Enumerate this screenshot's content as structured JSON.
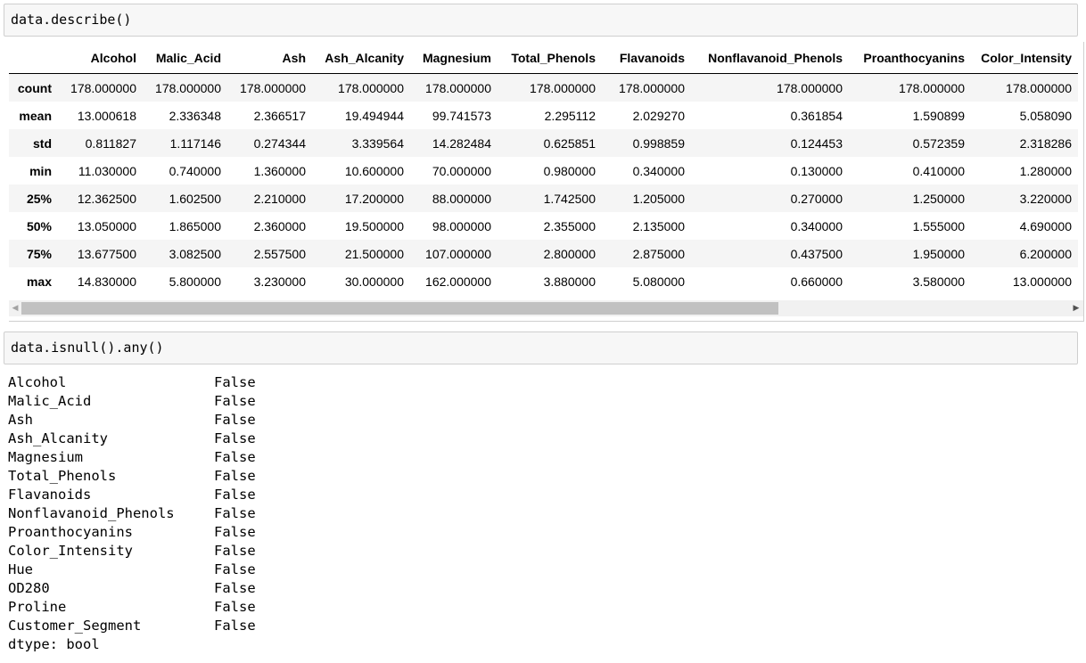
{
  "cells": {
    "describe_code": "data.describe()",
    "isnull_code": "data.isnull().any()"
  },
  "describe_table": {
    "columns": [
      "Alcohol",
      "Malic_Acid",
      "Ash",
      "Ash_Alcanity",
      "Magnesium",
      "Total_Phenols",
      "Flavanoids",
      "Nonflavanoid_Phenols",
      "Proanthocyanins",
      "Color_Intensity"
    ],
    "rows": [
      {
        "label": "count",
        "values": [
          "178.000000",
          "178.000000",
          "178.000000",
          "178.000000",
          "178.000000",
          "178.000000",
          "178.000000",
          "178.000000",
          "178.000000",
          "178.000000"
        ]
      },
      {
        "label": "mean",
        "values": [
          "13.000618",
          "2.336348",
          "2.366517",
          "19.494944",
          "99.741573",
          "2.295112",
          "2.029270",
          "0.361854",
          "1.590899",
          "5.058090"
        ]
      },
      {
        "label": "std",
        "values": [
          "0.811827",
          "1.117146",
          "0.274344",
          "3.339564",
          "14.282484",
          "0.625851",
          "0.998859",
          "0.124453",
          "0.572359",
          "2.318286"
        ]
      },
      {
        "label": "min",
        "values": [
          "11.030000",
          "0.740000",
          "1.360000",
          "10.600000",
          "70.000000",
          "0.980000",
          "0.340000",
          "0.130000",
          "0.410000",
          "1.280000"
        ]
      },
      {
        "label": "25%",
        "values": [
          "12.362500",
          "1.602500",
          "2.210000",
          "17.200000",
          "88.000000",
          "1.742500",
          "1.205000",
          "0.270000",
          "1.250000",
          "3.220000"
        ]
      },
      {
        "label": "50%",
        "values": [
          "13.050000",
          "1.865000",
          "2.360000",
          "19.500000",
          "98.000000",
          "2.355000",
          "2.135000",
          "0.340000",
          "1.555000",
          "4.690000"
        ]
      },
      {
        "label": "75%",
        "values": [
          "13.677500",
          "3.082500",
          "2.557500",
          "21.500000",
          "107.000000",
          "2.800000",
          "2.875000",
          "0.437500",
          "1.950000",
          "6.200000"
        ]
      },
      {
        "label": "max",
        "values": [
          "14.830000",
          "5.800000",
          "3.230000",
          "30.000000",
          "162.000000",
          "3.880000",
          "5.080000",
          "0.660000",
          "3.580000",
          "13.000000"
        ]
      }
    ]
  },
  "scrollbar": {
    "left_arrow_icon": "triangle-left-icon",
    "right_arrow_icon": "triangle-right-icon",
    "left_arrow_glyph": "◀",
    "right_arrow_glyph": "▶"
  },
  "isnull_output": {
    "rows": [
      {
        "name": "Alcohol",
        "value": "False"
      },
      {
        "name": "Malic_Acid",
        "value": "False"
      },
      {
        "name": "Ash",
        "value": "False"
      },
      {
        "name": "Ash_Alcanity",
        "value": "False"
      },
      {
        "name": "Magnesium",
        "value": "False"
      },
      {
        "name": "Total_Phenols",
        "value": "False"
      },
      {
        "name": "Flavanoids",
        "value": "False"
      },
      {
        "name": "Nonflavanoid_Phenols",
        "value": "False"
      },
      {
        "name": "Proanthocyanins",
        "value": "False"
      },
      {
        "name": "Color_Intensity",
        "value": "False"
      },
      {
        "name": "Hue",
        "value": "False"
      },
      {
        "name": "OD280",
        "value": "False"
      },
      {
        "name": "Proline",
        "value": "False"
      },
      {
        "name": "Customer_Segment",
        "value": "False"
      }
    ],
    "dtype": "dtype: bool"
  }
}
